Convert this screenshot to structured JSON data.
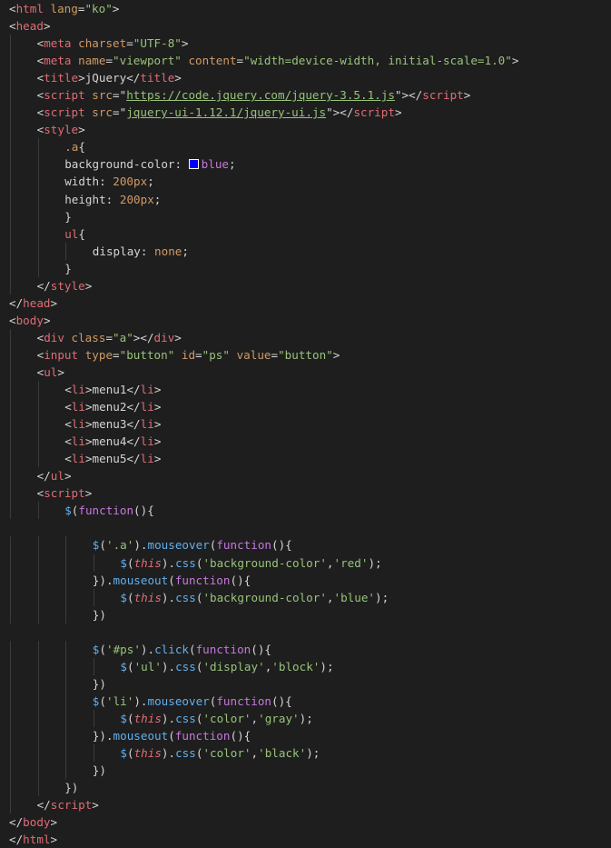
{
  "editor": {
    "language": "html",
    "theme_bg": "#1e1e1e",
    "colors": {
      "tag": "#e06c75",
      "attr": "#d19a66",
      "string": "#98c379",
      "keyword": "#c678dd",
      "function": "#61afef",
      "swatch_blue": "#0000ff"
    },
    "lines": [
      {
        "indent": 0,
        "tokens": [
          [
            "p",
            "<"
          ],
          [
            "tag",
            "html"
          ],
          [
            "attr",
            " lang"
          ],
          [
            "p",
            "="
          ],
          [
            "str",
            "\"ko\""
          ],
          [
            "p",
            ">"
          ]
        ]
      },
      {
        "indent": 0,
        "tokens": [
          [
            "p",
            "<"
          ],
          [
            "tag",
            "head"
          ],
          [
            "p",
            ">"
          ]
        ]
      },
      {
        "indent": 1,
        "tokens": [
          [
            "p",
            "<"
          ],
          [
            "tag",
            "meta"
          ],
          [
            "attr",
            " charset"
          ],
          [
            "p",
            "="
          ],
          [
            "str",
            "\"UTF-8\""
          ],
          [
            "p",
            ">"
          ]
        ]
      },
      {
        "indent": 1,
        "tokens": [
          [
            "p",
            "<"
          ],
          [
            "tag",
            "meta"
          ],
          [
            "attr",
            " name"
          ],
          [
            "p",
            "="
          ],
          [
            "str",
            "\"viewport\""
          ],
          [
            "attr",
            " content"
          ],
          [
            "p",
            "="
          ],
          [
            "str",
            "\"width=device-width, initial-scale=1.0\""
          ],
          [
            "p",
            ">"
          ]
        ]
      },
      {
        "indent": 1,
        "tokens": [
          [
            "p",
            "<"
          ],
          [
            "tag",
            "title"
          ],
          [
            "p",
            ">"
          ],
          [
            "val",
            "jQuery"
          ],
          [
            "p",
            "</"
          ],
          [
            "tag",
            "title"
          ],
          [
            "p",
            ">"
          ]
        ]
      },
      {
        "indent": 1,
        "tokens": [
          [
            "p",
            "<"
          ],
          [
            "tag",
            "script"
          ],
          [
            "attr",
            " src"
          ],
          [
            "p",
            "=\""
          ],
          [
            "link",
            "https://code.jquery.com/jquery-3.5.1.js"
          ],
          [
            "p",
            "\">"
          ],
          [
            "p",
            "</"
          ],
          [
            "tag",
            "script"
          ],
          [
            "p",
            ">"
          ]
        ]
      },
      {
        "indent": 1,
        "tokens": [
          [
            "p",
            "<"
          ],
          [
            "tag",
            "script"
          ],
          [
            "attr",
            " src"
          ],
          [
            "p",
            "=\""
          ],
          [
            "link",
            "jquery-ui-1.12.1/jquery-ui.js"
          ],
          [
            "p",
            "\">"
          ],
          [
            "p",
            "</"
          ],
          [
            "tag",
            "script"
          ],
          [
            "p",
            ">"
          ]
        ]
      },
      {
        "indent": 1,
        "tokens": [
          [
            "p",
            "<"
          ],
          [
            "tag",
            "style"
          ],
          [
            "p",
            ">"
          ]
        ]
      },
      {
        "indent": 2,
        "tokens": [
          [
            "sel",
            ".a"
          ],
          [
            "p",
            "{"
          ]
        ]
      },
      {
        "indent": 2,
        "tokens": [
          [
            "val",
            "background-color: "
          ],
          [
            "swatch",
            ""
          ],
          [
            "kw",
            "blue"
          ],
          [
            "p",
            ";"
          ]
        ]
      },
      {
        "indent": 2,
        "tokens": [
          [
            "val",
            "width: "
          ],
          [
            "num",
            "200px"
          ],
          [
            "p",
            ";"
          ]
        ]
      },
      {
        "indent": 2,
        "tokens": [
          [
            "val",
            "height: "
          ],
          [
            "num",
            "200px"
          ],
          [
            "p",
            ";"
          ]
        ]
      },
      {
        "indent": 2,
        "tokens": [
          [
            "p",
            "}"
          ]
        ]
      },
      {
        "indent": 2,
        "tokens": [
          [
            "tag",
            "ul"
          ],
          [
            "p",
            "{"
          ]
        ]
      },
      {
        "indent": 3,
        "tokens": [
          [
            "val",
            "display: "
          ],
          [
            "num",
            "none"
          ],
          [
            "p",
            ";"
          ]
        ]
      },
      {
        "indent": 2,
        "tokens": [
          [
            "p",
            "}"
          ]
        ]
      },
      {
        "indent": 1,
        "tokens": [
          [
            "p",
            "</"
          ],
          [
            "tag",
            "style"
          ],
          [
            "p",
            ">"
          ]
        ]
      },
      {
        "indent": 0,
        "tokens": [
          [
            "p",
            "</"
          ],
          [
            "tag",
            "head"
          ],
          [
            "p",
            ">"
          ]
        ]
      },
      {
        "indent": 0,
        "tokens": [
          [
            "p",
            "<"
          ],
          [
            "tag",
            "body"
          ],
          [
            "p",
            ">"
          ]
        ]
      },
      {
        "indent": 1,
        "tokens": [
          [
            "p",
            "<"
          ],
          [
            "tag",
            "div"
          ],
          [
            "attr",
            " class"
          ],
          [
            "p",
            "="
          ],
          [
            "str",
            "\"a\""
          ],
          [
            "p",
            "></"
          ],
          [
            "tag",
            "div"
          ],
          [
            "p",
            ">"
          ]
        ]
      },
      {
        "indent": 1,
        "tokens": [
          [
            "p",
            "<"
          ],
          [
            "tag",
            "input"
          ],
          [
            "attr",
            " type"
          ],
          [
            "p",
            "="
          ],
          [
            "str",
            "\"button\""
          ],
          [
            "attr",
            " id"
          ],
          [
            "p",
            "="
          ],
          [
            "str",
            "\"ps\""
          ],
          [
            "attr",
            " value"
          ],
          [
            "p",
            "="
          ],
          [
            "str",
            "\"button\""
          ],
          [
            "p",
            ">"
          ]
        ]
      },
      {
        "indent": 1,
        "tokens": [
          [
            "p",
            "<"
          ],
          [
            "tag",
            "ul"
          ],
          [
            "p",
            ">"
          ]
        ]
      },
      {
        "indent": 2,
        "tokens": [
          [
            "p",
            "<"
          ],
          [
            "tag",
            "li"
          ],
          [
            "p",
            ">"
          ],
          [
            "val",
            "menu1"
          ],
          [
            "p",
            "</"
          ],
          [
            "tag",
            "li"
          ],
          [
            "p",
            ">"
          ]
        ]
      },
      {
        "indent": 2,
        "tokens": [
          [
            "p",
            "<"
          ],
          [
            "tag",
            "li"
          ],
          [
            "p",
            ">"
          ],
          [
            "val",
            "menu2"
          ],
          [
            "p",
            "</"
          ],
          [
            "tag",
            "li"
          ],
          [
            "p",
            ">"
          ]
        ]
      },
      {
        "indent": 2,
        "tokens": [
          [
            "p",
            "<"
          ],
          [
            "tag",
            "li"
          ],
          [
            "p",
            ">"
          ],
          [
            "val",
            "menu3"
          ],
          [
            "p",
            "</"
          ],
          [
            "tag",
            "li"
          ],
          [
            "p",
            ">"
          ]
        ]
      },
      {
        "indent": 2,
        "tokens": [
          [
            "p",
            "<"
          ],
          [
            "tag",
            "li"
          ],
          [
            "p",
            ">"
          ],
          [
            "val",
            "menu4"
          ],
          [
            "p",
            "</"
          ],
          [
            "tag",
            "li"
          ],
          [
            "p",
            ">"
          ]
        ]
      },
      {
        "indent": 2,
        "tokens": [
          [
            "p",
            "<"
          ],
          [
            "tag",
            "li"
          ],
          [
            "p",
            ">"
          ],
          [
            "val",
            "menu5"
          ],
          [
            "p",
            "</"
          ],
          [
            "tag",
            "li"
          ],
          [
            "p",
            ">"
          ]
        ]
      },
      {
        "indent": 1,
        "tokens": [
          [
            "p",
            "</"
          ],
          [
            "tag",
            "ul"
          ],
          [
            "p",
            ">"
          ]
        ]
      },
      {
        "indent": 1,
        "tokens": [
          [
            "p",
            "<"
          ],
          [
            "tag",
            "script"
          ],
          [
            "p",
            ">"
          ]
        ]
      },
      {
        "indent": 2,
        "tokens": [
          [
            "fn",
            "$"
          ],
          [
            "p",
            "("
          ],
          [
            "kw",
            "function"
          ],
          [
            "p",
            "(){"
          ]
        ]
      },
      {
        "indent": 0,
        "tokens": []
      },
      {
        "indent": 3,
        "tokens": [
          [
            "fn",
            "$"
          ],
          [
            "p",
            "("
          ],
          [
            "str",
            "'.a'"
          ],
          [
            "p",
            ")."
          ],
          [
            "fn",
            "mouseover"
          ],
          [
            "p",
            "("
          ],
          [
            "kw",
            "function"
          ],
          [
            "p",
            "(){"
          ]
        ]
      },
      {
        "indent": 4,
        "tokens": [
          [
            "fn",
            "$"
          ],
          [
            "p",
            "("
          ],
          [
            "this",
            "this"
          ],
          [
            "p",
            ")."
          ],
          [
            "fn",
            "css"
          ],
          [
            "p",
            "("
          ],
          [
            "str",
            "'background-color'"
          ],
          [
            "p",
            ","
          ],
          [
            "str",
            "'red'"
          ],
          [
            "p",
            ");"
          ]
        ]
      },
      {
        "indent": 3,
        "tokens": [
          [
            "p",
            "})."
          ],
          [
            "fn",
            "mouseout"
          ],
          [
            "p",
            "("
          ],
          [
            "kw",
            "function"
          ],
          [
            "p",
            "(){"
          ]
        ]
      },
      {
        "indent": 4,
        "tokens": [
          [
            "fn",
            "$"
          ],
          [
            "p",
            "("
          ],
          [
            "this",
            "this"
          ],
          [
            "p",
            ")."
          ],
          [
            "fn",
            "css"
          ],
          [
            "p",
            "("
          ],
          [
            "str",
            "'background-color'"
          ],
          [
            "p",
            ","
          ],
          [
            "str",
            "'blue'"
          ],
          [
            "p",
            ");"
          ]
        ]
      },
      {
        "indent": 3,
        "tokens": [
          [
            "p",
            "})"
          ]
        ]
      },
      {
        "indent": 0,
        "tokens": []
      },
      {
        "indent": 3,
        "tokens": [
          [
            "fn",
            "$"
          ],
          [
            "p",
            "("
          ],
          [
            "str",
            "'#ps'"
          ],
          [
            "p",
            ")."
          ],
          [
            "fn",
            "click"
          ],
          [
            "p",
            "("
          ],
          [
            "kw",
            "function"
          ],
          [
            "p",
            "(){"
          ]
        ]
      },
      {
        "indent": 4,
        "tokens": [
          [
            "fn",
            "$"
          ],
          [
            "p",
            "("
          ],
          [
            "str",
            "'ul'"
          ],
          [
            "p",
            ")."
          ],
          [
            "fn",
            "css"
          ],
          [
            "p",
            "("
          ],
          [
            "str",
            "'display'"
          ],
          [
            "p",
            ","
          ],
          [
            "str",
            "'block'"
          ],
          [
            "p",
            ");"
          ]
        ]
      },
      {
        "indent": 3,
        "tokens": [
          [
            "p",
            "})"
          ]
        ]
      },
      {
        "indent": 3,
        "tokens": [
          [
            "fn",
            "$"
          ],
          [
            "p",
            "("
          ],
          [
            "str",
            "'li'"
          ],
          [
            "p",
            ")."
          ],
          [
            "fn",
            "mouseover"
          ],
          [
            "p",
            "("
          ],
          [
            "kw",
            "function"
          ],
          [
            "p",
            "(){"
          ]
        ]
      },
      {
        "indent": 4,
        "tokens": [
          [
            "fn",
            "$"
          ],
          [
            "p",
            "("
          ],
          [
            "this",
            "this"
          ],
          [
            "p",
            ")."
          ],
          [
            "fn",
            "css"
          ],
          [
            "p",
            "("
          ],
          [
            "str",
            "'color'"
          ],
          [
            "p",
            ","
          ],
          [
            "str",
            "'gray'"
          ],
          [
            "p",
            ");"
          ]
        ]
      },
      {
        "indent": 3,
        "tokens": [
          [
            "p",
            "})."
          ],
          [
            "fn",
            "mouseout"
          ],
          [
            "p",
            "("
          ],
          [
            "kw",
            "function"
          ],
          [
            "p",
            "(){"
          ]
        ]
      },
      {
        "indent": 4,
        "tokens": [
          [
            "fn",
            "$"
          ],
          [
            "p",
            "("
          ],
          [
            "this",
            "this"
          ],
          [
            "p",
            ")."
          ],
          [
            "fn",
            "css"
          ],
          [
            "p",
            "("
          ],
          [
            "str",
            "'color'"
          ],
          [
            "p",
            ","
          ],
          [
            "str",
            "'black'"
          ],
          [
            "p",
            ");"
          ]
        ]
      },
      {
        "indent": 3,
        "tokens": [
          [
            "p",
            "})"
          ]
        ]
      },
      {
        "indent": 2,
        "tokens": [
          [
            "p",
            "})"
          ]
        ]
      },
      {
        "indent": 1,
        "tokens": [
          [
            "p",
            "</"
          ],
          [
            "tag",
            "script"
          ],
          [
            "p",
            ">"
          ]
        ]
      },
      {
        "indent": 0,
        "tokens": [
          [
            "p",
            "</"
          ],
          [
            "tag",
            "body"
          ],
          [
            "p",
            ">"
          ]
        ]
      },
      {
        "indent": 0,
        "tokens": [
          [
            "p",
            "</"
          ],
          [
            "tag",
            "html"
          ],
          [
            "p",
            ">"
          ]
        ]
      }
    ]
  }
}
